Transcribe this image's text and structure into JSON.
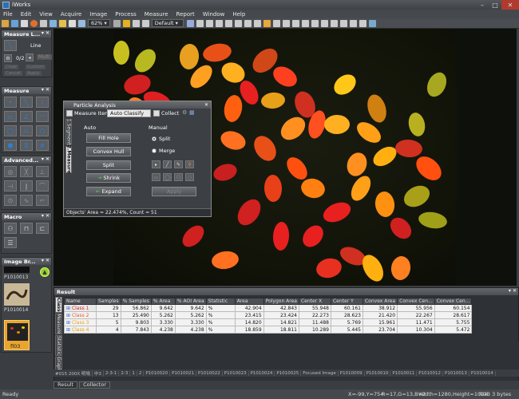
{
  "app": {
    "title": "iWorks"
  },
  "menu": [
    "File",
    "Edit",
    "View",
    "Acquire",
    "Image",
    "Process",
    "Measure",
    "Report",
    "Window",
    "Help"
  ],
  "toolbar": {
    "zoom": "62%",
    "preset": "Default"
  },
  "panels": {
    "measure_line": {
      "title": "Measure L...",
      "mode": "Line",
      "counter": "0/2",
      "btns": [
        "Multi",
        "Clear",
        "Custom",
        "Cancel",
        "Apply"
      ]
    },
    "measure": {
      "title": "Measure"
    },
    "advanced": {
      "title": "Advanced..."
    },
    "macro": {
      "title": "Macro"
    },
    "image_browser": {
      "title": "Image Br...",
      "items": [
        "P1010013",
        "P1010014",
        "fl03"
      ]
    }
  },
  "dialog": {
    "title": "Particle Analysis",
    "measure_item_label": "Measure Item",
    "measure_item_value": "Auto Classify",
    "collect_label": "Collect",
    "tabs": [
      "1.Segment",
      "2.Measure"
    ],
    "auto_label": "Auto",
    "manual_label": "Manual",
    "buttons": [
      "Fill Hole",
      "Convex Hull",
      "Split",
      "Shrink",
      "Expand"
    ],
    "split_radio": "Split",
    "merge_radio": "Merge",
    "apply": "Apply",
    "status": "Objects' Area = 22.474%, Count = 51"
  },
  "result": {
    "title": "Result",
    "side_tabs": [
      "Class",
      "Measure",
      "Statistic",
      "Graph"
    ],
    "columns": [
      "Name",
      "Samples",
      "% Samples",
      "% Area",
      "% AOI Area",
      "Statistic",
      "Area",
      "Polygon Area",
      "Center X",
      "Center Y",
      "Convex Area",
      "Convex Cen...",
      "Convex Cen..."
    ],
    "rows": [
      {
        "name": "Class 1",
        "color": "#d62828",
        "cells": [
          "29",
          "56.862",
          "9.642",
          "9.642",
          "%",
          "42.904",
          "42.843",
          "55.948",
          "60.161",
          "38.912",
          "55.956",
          "60.154"
        ]
      },
      {
        "name": "Class 2",
        "color": "#e85a1a",
        "cells": [
          "13",
          "25.490",
          "5.262",
          "5.262",
          "%",
          "23.415",
          "23.424",
          "22.273",
          "28.623",
          "21.420",
          "22.267",
          "28.617"
        ]
      },
      {
        "name": "Class 3",
        "color": "#f0a020",
        "cells": [
          "5",
          "9.803",
          "3.330",
          "3.330",
          "%",
          "14.820",
          "14.821",
          "11.488",
          "5.769",
          "15.961",
          "11.471",
          "5.755"
        ]
      },
      {
        "name": "Class 4",
        "color": "#e0a000",
        "cells": [
          "4",
          "7.843",
          "4.238",
          "4.238",
          "%",
          "18.859",
          "18.811",
          "10.289",
          "5.445",
          "23.704",
          "10.304",
          "5.472"
        ]
      }
    ]
  },
  "filmstrip": [
    "#015 200X 明場",
    "中3",
    "2-3-1",
    "2-3",
    "1",
    "2",
    "P1010020",
    "P1010021",
    "P1010022",
    "P1010023",
    "P1010024",
    "P1010025",
    "Focused Image",
    "P1010009",
    "P1010010",
    "P1010011",
    "P1010012",
    "P1010013",
    "P1010014"
  ],
  "bottom_tabs": [
    "Result",
    "Collector"
  ],
  "status": {
    "left": "Ready",
    "coords": "X=-99,Y=754",
    "rgb": "R=17,G=13,B=2",
    "size": "Width=1280,Height=1024",
    "format": "RGB 3 bytes"
  }
}
